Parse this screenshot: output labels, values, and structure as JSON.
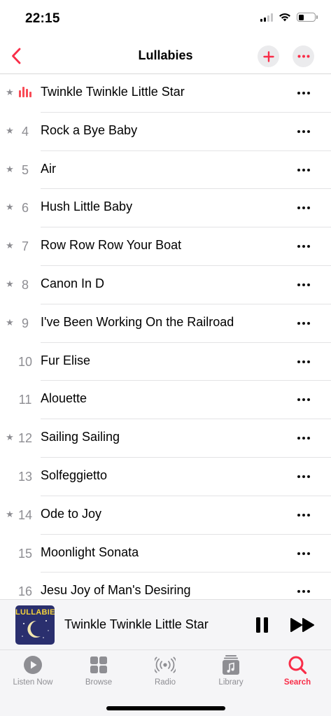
{
  "status_bar": {
    "time": "22:15",
    "battery_level": 0.35
  },
  "nav": {
    "title": "Lullabies",
    "back_icon": "chevron-left-icon",
    "add_icon": "plus-icon",
    "more_icon": "ellipsis-icon"
  },
  "accent_color": "#f92d48",
  "tracks": [
    {
      "number": "",
      "title": "Twinkle Twinkle Little Star",
      "starred": true,
      "now_playing": true
    },
    {
      "number": "4",
      "title": "Rock a Bye Baby",
      "starred": true,
      "now_playing": false
    },
    {
      "number": "5",
      "title": "Air",
      "starred": true,
      "now_playing": false
    },
    {
      "number": "6",
      "title": "Hush Little Baby",
      "starred": true,
      "now_playing": false
    },
    {
      "number": "7",
      "title": "Row Row Row Your Boat",
      "starred": true,
      "now_playing": false
    },
    {
      "number": "8",
      "title": "Canon In D",
      "starred": true,
      "now_playing": false
    },
    {
      "number": "9",
      "title": "I've Been Working On the Railroad",
      "starred": true,
      "now_playing": false
    },
    {
      "number": "10",
      "title": "Fur Elise",
      "starred": false,
      "now_playing": false
    },
    {
      "number": "11",
      "title": "Alouette",
      "starred": false,
      "now_playing": false
    },
    {
      "number": "12",
      "title": "Sailing Sailing",
      "starred": true,
      "now_playing": false
    },
    {
      "number": "13",
      "title": "Solfeggietto",
      "starred": false,
      "now_playing": false
    },
    {
      "number": "14",
      "title": "Ode to Joy",
      "starred": true,
      "now_playing": false
    },
    {
      "number": "15",
      "title": "Moonlight Sonata",
      "starred": false,
      "now_playing": false
    },
    {
      "number": "16",
      "title": "Jesu Joy of Man's Desiring",
      "starred": false,
      "now_playing": false
    }
  ],
  "star_glyph": "★",
  "mini_player": {
    "artwork_label": "LULLABIES",
    "title": "Twinkle Twinkle Little Star",
    "pause_icon": "pause-icon",
    "forward_icon": "forward-icon"
  },
  "tabs": [
    {
      "label": "Listen Now",
      "icon": "play-circle-icon",
      "active": false
    },
    {
      "label": "Browse",
      "icon": "grid-icon",
      "active": false
    },
    {
      "label": "Radio",
      "icon": "radio-icon",
      "active": false
    },
    {
      "label": "Library",
      "icon": "library-icon",
      "active": false
    },
    {
      "label": "Search",
      "icon": "search-icon",
      "active": true
    }
  ]
}
